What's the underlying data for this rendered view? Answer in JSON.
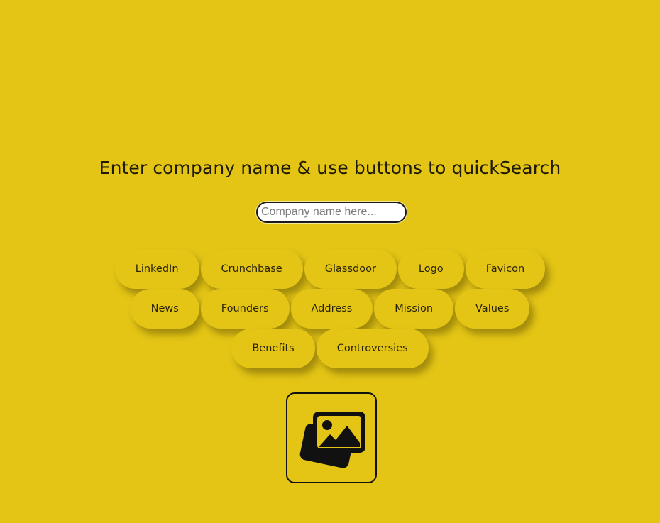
{
  "heading": "Enter company name & use buttons to quickSearch",
  "search": {
    "placeholder": "Company name here...",
    "value": ""
  },
  "buttons": {
    "row1": [
      "LinkedIn",
      "Crunchbase",
      "Glassdoor",
      "Logo",
      "Favicon"
    ],
    "row2": [
      "News",
      "Founders",
      "Address",
      "Mission",
      "Values"
    ],
    "row3": [
      "Benefits",
      "Controversies"
    ]
  },
  "image_button": {
    "icon": "images-icon"
  },
  "colors": {
    "background": "#e4c515",
    "text": "#1f1a05",
    "icon": "#111111"
  }
}
